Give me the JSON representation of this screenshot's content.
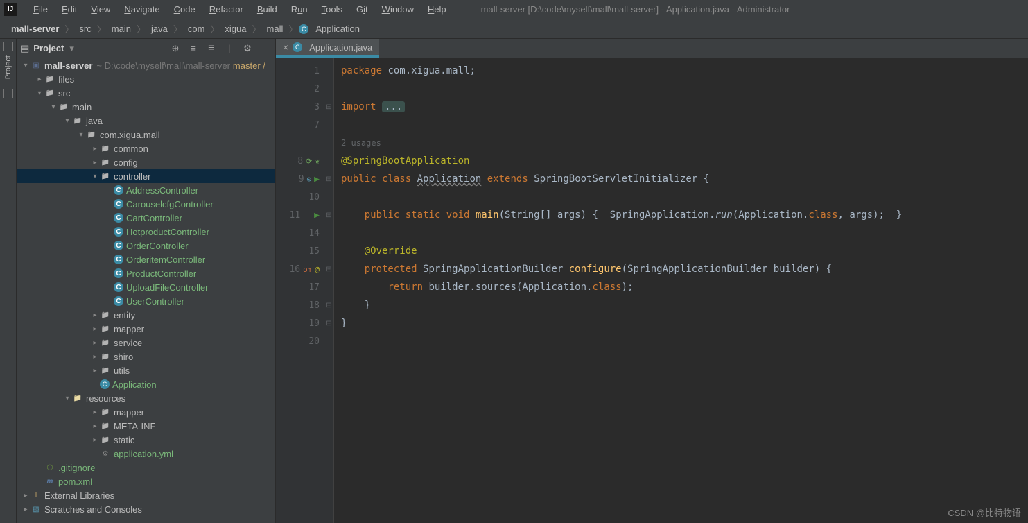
{
  "menubar": {
    "items": [
      "File",
      "Edit",
      "View",
      "Navigate",
      "Code",
      "Refactor",
      "Build",
      "Run",
      "Tools",
      "Git",
      "Window",
      "Help"
    ],
    "title": "mall-server [D:\\code\\myself\\mall\\mall-server] - Application.java - Administrator"
  },
  "breadcrumb": {
    "items": [
      "mall-server",
      "src",
      "main",
      "java",
      "com",
      "xigua",
      "mall",
      "Application"
    ]
  },
  "tool": {
    "title": "Project",
    "rail": "Project"
  },
  "tree": {
    "root": {
      "name": "mall-server",
      "path": "~ D:\\code\\myself\\mall\\mall-server",
      "branch": "master /"
    },
    "files": "files",
    "src": "src",
    "main": "main",
    "java": "java",
    "pkg": "com.xigua.mall",
    "common": "common",
    "config": "config",
    "controller": "controller",
    "controllers": [
      "AddressController",
      "CarouselcfgController",
      "CartController",
      "HotproductController",
      "OrderController",
      "OrderitemController",
      "ProductController",
      "UploadFileController",
      "UserController"
    ],
    "entity": "entity",
    "mapper": "mapper",
    "service": "service",
    "shiro": "shiro",
    "utils": "utils",
    "app": "Application",
    "resources": "resources",
    "res_mapper": "mapper",
    "metainf": "META-INF",
    "static": "static",
    "appyml": "application.yml",
    "gitignore": ".gitignore",
    "pom": "pom.xml",
    "extlib": "External Libraries",
    "scratch": "Scratches and Consoles"
  },
  "tab": {
    "name": "Application.java"
  },
  "code": {
    "line_nums": [
      "1",
      "2",
      "3",
      "7",
      "",
      "8",
      "9",
      "10",
      "11",
      "14",
      "15",
      "16",
      "17",
      "18",
      "19",
      "20"
    ],
    "usages": "2 usages",
    "pkg": "com.xigua.mall",
    "ann": "@SpringBootApplication",
    "cls": "Application",
    "ext": "SpringBootServletInitializer",
    "main_arg": "String[] args",
    "run_call": "SpringApplication.",
    "run_m": "run",
    "run_args": "(Application.",
    "class_kw": "class",
    "override": "@Override",
    "conf_ret": "SpringApplicationBuilder",
    "conf": "configure",
    "conf_args": "(SpringApplicationBuilder builder)",
    "ret_expr": "builder.sources(Application."
  },
  "credit": "CSDN @比特物语"
}
